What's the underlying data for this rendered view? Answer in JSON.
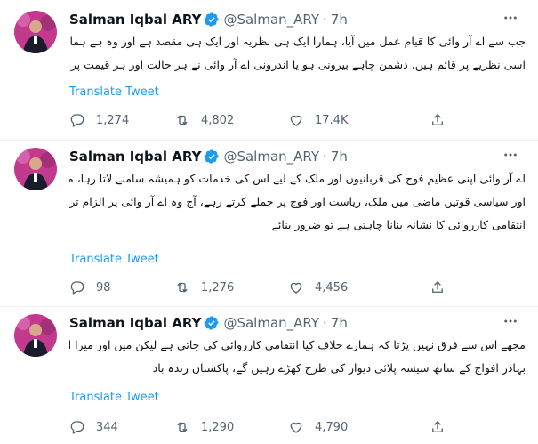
{
  "tweets": [
    {
      "name": "Salman Iqbal ARY",
      "handle": "@Salman_ARY",
      "separator": "·",
      "time": "7h",
      "lines": [
        "جب سے اے آر وائی کا قیام عمل میں آیا، ہمارا ایک ہی نظریہ اور ایک ہی مقصد ہے اور وہ ہے ہمارا عظیم وطن پاکستان، ہم آج بھی",
        "اسی نظریے پر قائم ہیں، دشمن چاہے بیرونی ہو یا اندرونی اے آر وائی نے ہر حالت اور ہر قیمت پر اپنے ملک اور افواج کا دفاع کیا"
      ],
      "translate": "Translate Tweet",
      "replies": "1,274",
      "retweets": "4,802",
      "likes": "17.4K"
    },
    {
      "name": "Salman Iqbal ARY",
      "handle": "@Salman_ARY",
      "separator": "·",
      "time": "7h",
      "lines": [
        "اے آر وائی اپنی عظیم فوج کی قربانیوں اور ملک کے لیے اس کی خدمات کو ہمیشہ سامنے لاتا رہا، میں حیران ہوں کہ جو نااہل",
        "اور سیاسی قوتیں ماضی میں ملک، ریاست اور فوج پر حملے کرتے رہے، آج وہ اے آر وائی پر الزام تراشی کر رہی ہیں، حکومت ہمیں سیاسی",
        "انتقامی کارروائی کا نشانہ بنانا چاہتی ہے تو ضرور بنائے"
      ],
      "translate": "Translate Tweet",
      "replies": "98",
      "retweets": "1,276",
      "likes": "4,456"
    },
    {
      "name": "Salman Iqbal ARY",
      "handle": "@Salman_ARY",
      "separator": "·",
      "time": "7h",
      "lines": [
        "مجھے اس سے فرق نہیں پڑتا کہ ہمارے خلاف کیا انتقامی کارروائی کی جاتی ہے لیکن میں اور میرا ادارہ اپنے عظیم وطن اور اپنی",
        "بہادر افواج کے ساتھ سیسہ پلائی دیوار کی طرح کھڑے رہیں گے، پاکستان زندہ باد"
      ],
      "translate": "Translate Tweet",
      "replies": "344",
      "retweets": "1,290",
      "likes": "4,790"
    }
  ],
  "icons": {
    "verified": "verified-badge-icon",
    "more": "more-dots-icon",
    "reply": "reply-icon",
    "retweet": "retweet-icon",
    "like": "like-heart-icon",
    "share": "share-icon"
  },
  "colors": {
    "accent": "#1d9bf0",
    "secondary": "#536471",
    "avatar_bg": "#c23a8e"
  }
}
